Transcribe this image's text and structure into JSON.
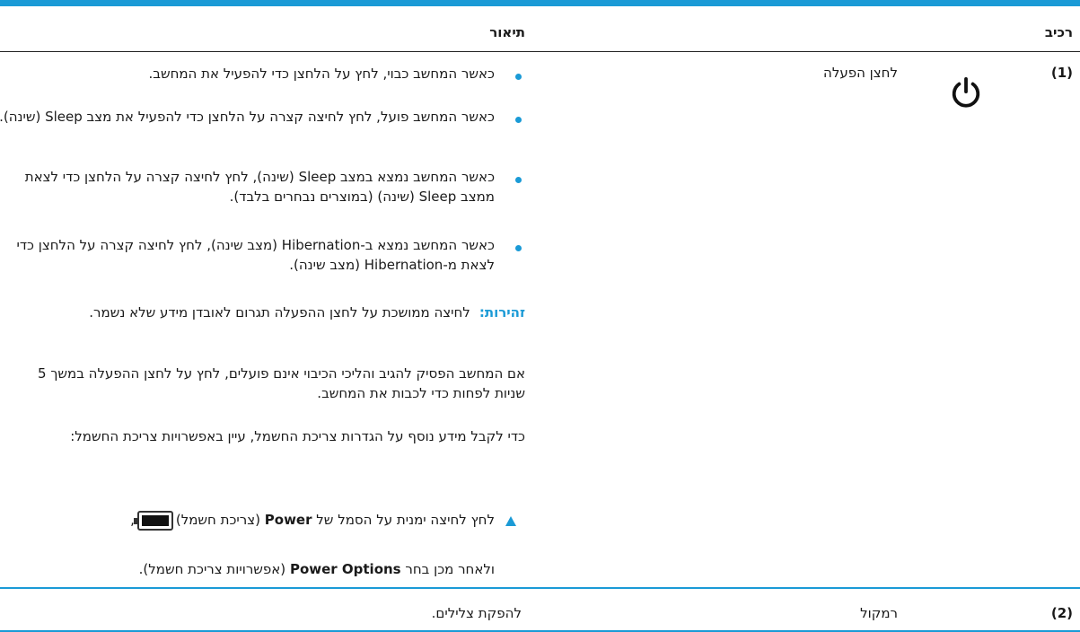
{
  "table": {
    "header_component": "רכיב",
    "header_description": "תיאור"
  },
  "row1": {
    "number": "(1)",
    "icon": "power-icon",
    "name": "לחצן הפעלה",
    "bullets": [
      "כאשר המחשב כבוי, לחץ על הלחצן כדי להפעיל את המחשב.",
      "כאשר המחשב פועל, לחץ לחיצה קצרה על הלחצן כדי להפעיל את מצב Sleep (שינה).",
      "כאשר המחשב נמצא במצב Sleep (שינה), לחץ לחיצה קצרה על הלחצן כדי לצאת ממצב Sleep (שינה) (במוצרים נבחרים בלבד).",
      "כאשר המחשב נמצא ב-Hibernation (מצב שינה), לחץ לחיצה קצרה על הלחצן כדי לצאת מ-Hibernation (מצב שינה)."
    ],
    "warning_label": "זהירות:",
    "warning_text": "לחיצה ממושכת על לחצן ההפעלה תגרום לאובדן מידע שלא נשמר.",
    "para1": "אם המחשב הפסיק להגיב והליכי הכיבוי אינם פועלים, לחץ על לחצן ההפעלה במשך 5 שניות לפחות כדי לכבות את המחשב.",
    "para2": "כדי לקבל מידע נוסף על הגדרות צריכת החשמל, עיין באפשרויות צריכת החשמל:",
    "step_prefix": "לחץ לחיצה ימנית על הסמל של",
    "step_bold1": "Power",
    "step_mid": "(צריכת חשמל)",
    "step_battery_icon": "battery-icon",
    "step_comma": ",",
    "step2_prefix": "ולאחר מכן בחר",
    "step_bold2": "Power Options",
    "step2_suffix": "(אפשרויות צריכת חשמל)."
  },
  "row2": {
    "number": "(2)",
    "name": "רמקול",
    "description": "להפקת צלילים."
  },
  "colors": {
    "accent": "#1a9ad6",
    "text": "#1a1a1a"
  }
}
